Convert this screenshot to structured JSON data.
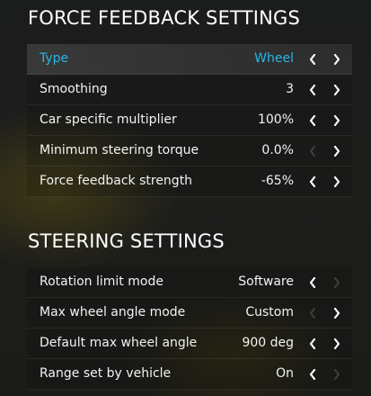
{
  "force_feedback": {
    "title": "FORCE FEEDBACK SETTINGS",
    "rows": [
      {
        "label": "Type",
        "value": "Wheel",
        "selected": true,
        "left_enabled": true,
        "right_enabled": true
      },
      {
        "label": "Smoothing",
        "value": "3",
        "selected": false,
        "left_enabled": true,
        "right_enabled": true
      },
      {
        "label": "Car specific multiplier",
        "value": "100%",
        "selected": false,
        "left_enabled": true,
        "right_enabled": true
      },
      {
        "label": "Minimum steering torque",
        "value": "0.0%",
        "selected": false,
        "left_enabled": false,
        "right_enabled": true
      },
      {
        "label": "Force feedback strength",
        "value": "-65%",
        "selected": false,
        "left_enabled": true,
        "right_enabled": true
      }
    ]
  },
  "steering": {
    "title": "STEERING SETTINGS",
    "rows": [
      {
        "label": "Rotation limit mode",
        "value": "Software",
        "selected": false,
        "left_enabled": true,
        "right_enabled": false
      },
      {
        "label": "Max wheel angle mode",
        "value": "Custom",
        "selected": false,
        "left_enabled": false,
        "right_enabled": true
      },
      {
        "label": "Default max wheel angle",
        "value": "900 deg",
        "selected": false,
        "left_enabled": true,
        "right_enabled": true
      },
      {
        "label": "Range set by vehicle",
        "value": "On",
        "selected": false,
        "left_enabled": true,
        "right_enabled": false
      }
    ]
  },
  "colors": {
    "accent": "#29b6e8",
    "text": "#f2f2f2",
    "background": "#1c1d1b"
  },
  "icons": {
    "left": "chevron-left-icon",
    "right": "chevron-right-icon"
  }
}
